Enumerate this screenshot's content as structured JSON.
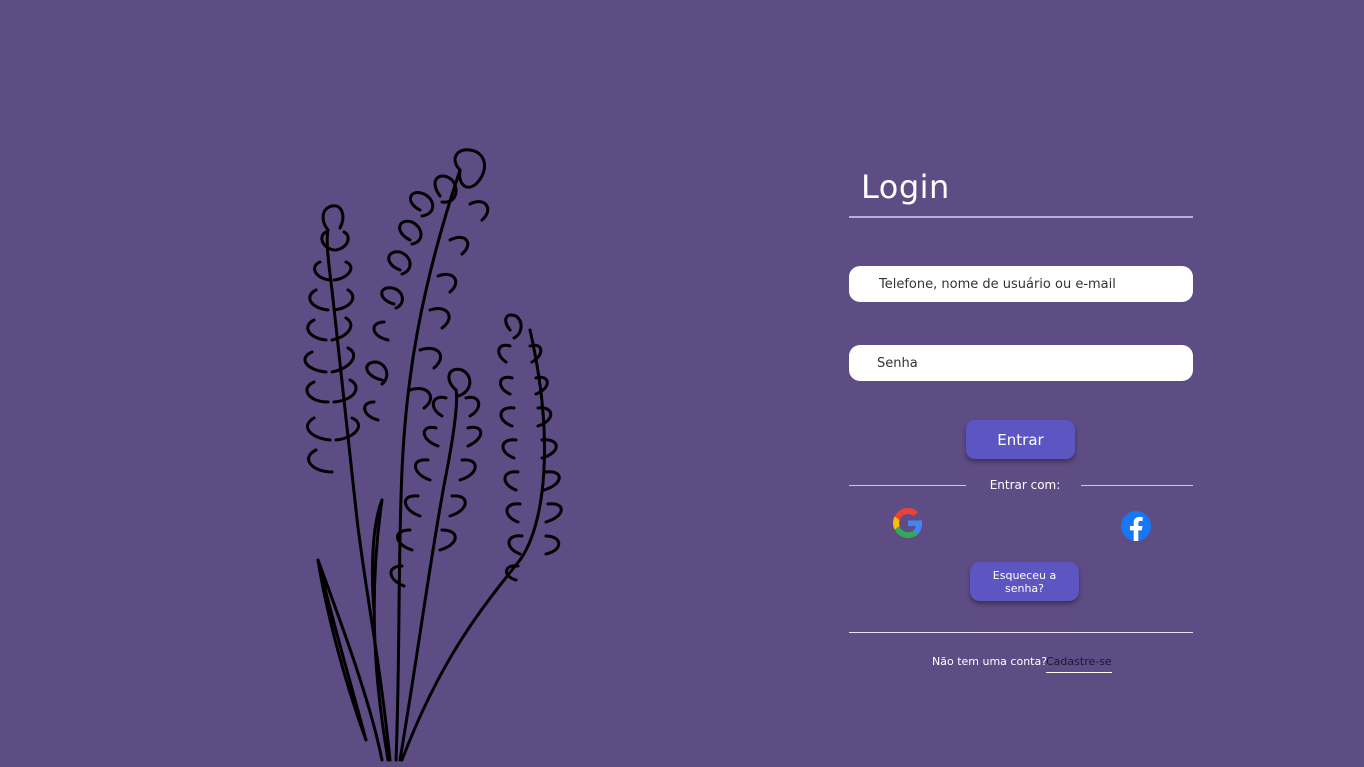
{
  "illustration": {
    "icon": "lavender-flower-illustration"
  },
  "login": {
    "title": "Login",
    "username_placeholder": "Telefone, nome de usuário ou e-mail",
    "password_placeholder": "Senha",
    "submit_label": "Entrar",
    "social_divider": "Entrar com:",
    "social": [
      {
        "icon": "google-icon"
      },
      {
        "icon": "facebook-icon"
      }
    ],
    "forgot_label": "Esqueceu a senha?",
    "no_account_text": "Não tem uma conta?",
    "signup_label": "Cadastre-se"
  },
  "colors": {
    "background": "#5e4c84",
    "button": "#5c55c2",
    "facebook": "#1877f2"
  }
}
